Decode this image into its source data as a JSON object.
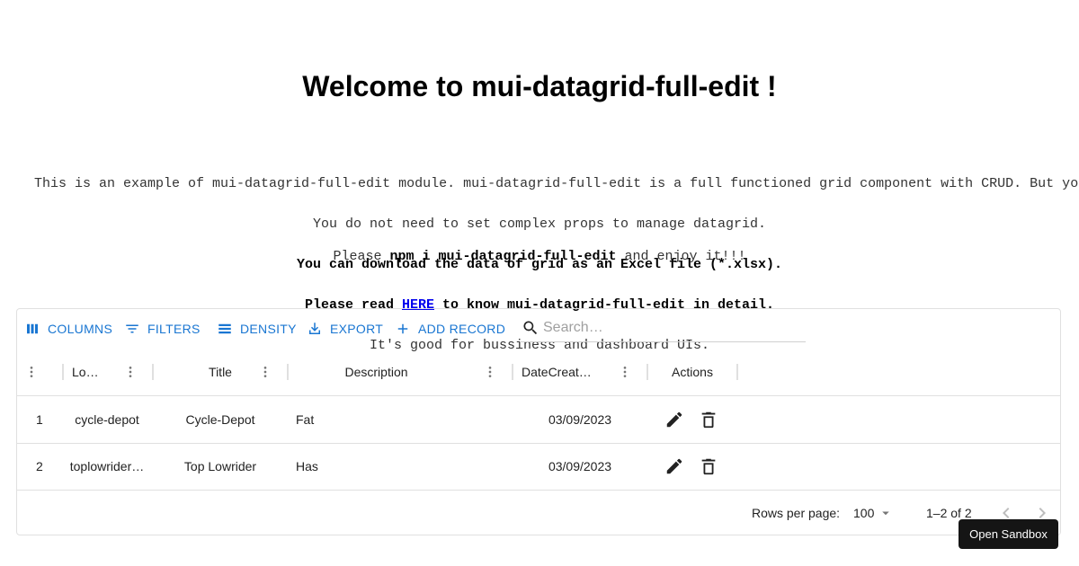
{
  "page": {
    "title": "Welcome to mui-datagrid-full-edit !",
    "intro": {
      "line1": "This is an example of mui-datagrid-full-edit module. mui-datagrid-full-edit is a full functioned grid component with CRUD. But yo",
      "line2": "You do not need to set complex props to manage datagrid.",
      "line3": "You can download the data of grid as an Excel file (*.xlsx).",
      "line4_prefix": "Please read ",
      "line4_link": "HERE",
      "line4_suffix": " to know mui-datagrid-full-edit in detail.",
      "line5": "It's good for bussiness and dashboard UIs."
    },
    "npm": {
      "prefix": "Please ",
      "command": "npm i mui-datagrid-full-edit",
      "suffix": " and enjoy it!!!"
    }
  },
  "toolbar": {
    "columns_label": "COLUMNS",
    "filters_label": "FILTERS",
    "density_label": "DENSITY",
    "export_label": "EXPORT",
    "add_record_label": "ADD RECORD",
    "search_placeholder": "Search…",
    "search_value": ""
  },
  "columns": [
    {
      "key": "id",
      "label": ""
    },
    {
      "key": "login",
      "label": "Lo…"
    },
    {
      "key": "title",
      "label": "Title"
    },
    {
      "key": "description",
      "label": "Description"
    },
    {
      "key": "date_created",
      "label": "DateCreat…"
    },
    {
      "key": "actions",
      "label": "Actions"
    }
  ],
  "rows": [
    {
      "id": "1",
      "login": "cycle-depot",
      "title": "Cycle-Depot",
      "description": "Fat",
      "date_created": "03/09/2023"
    },
    {
      "id": "2",
      "login": "toplowrider…",
      "title": "Top Lowrider",
      "description": "Has",
      "date_created": "03/09/2023"
    }
  ],
  "footer": {
    "rows_per_page_label": "Rows per page:",
    "rows_per_page_value": "100",
    "pagination_text": "1–2 of 2"
  },
  "sandbox_button": "Open Sandbox",
  "colors": {
    "accent": "#1976d2",
    "link": "#0000ee",
    "tooltip_bg": "#151515"
  }
}
